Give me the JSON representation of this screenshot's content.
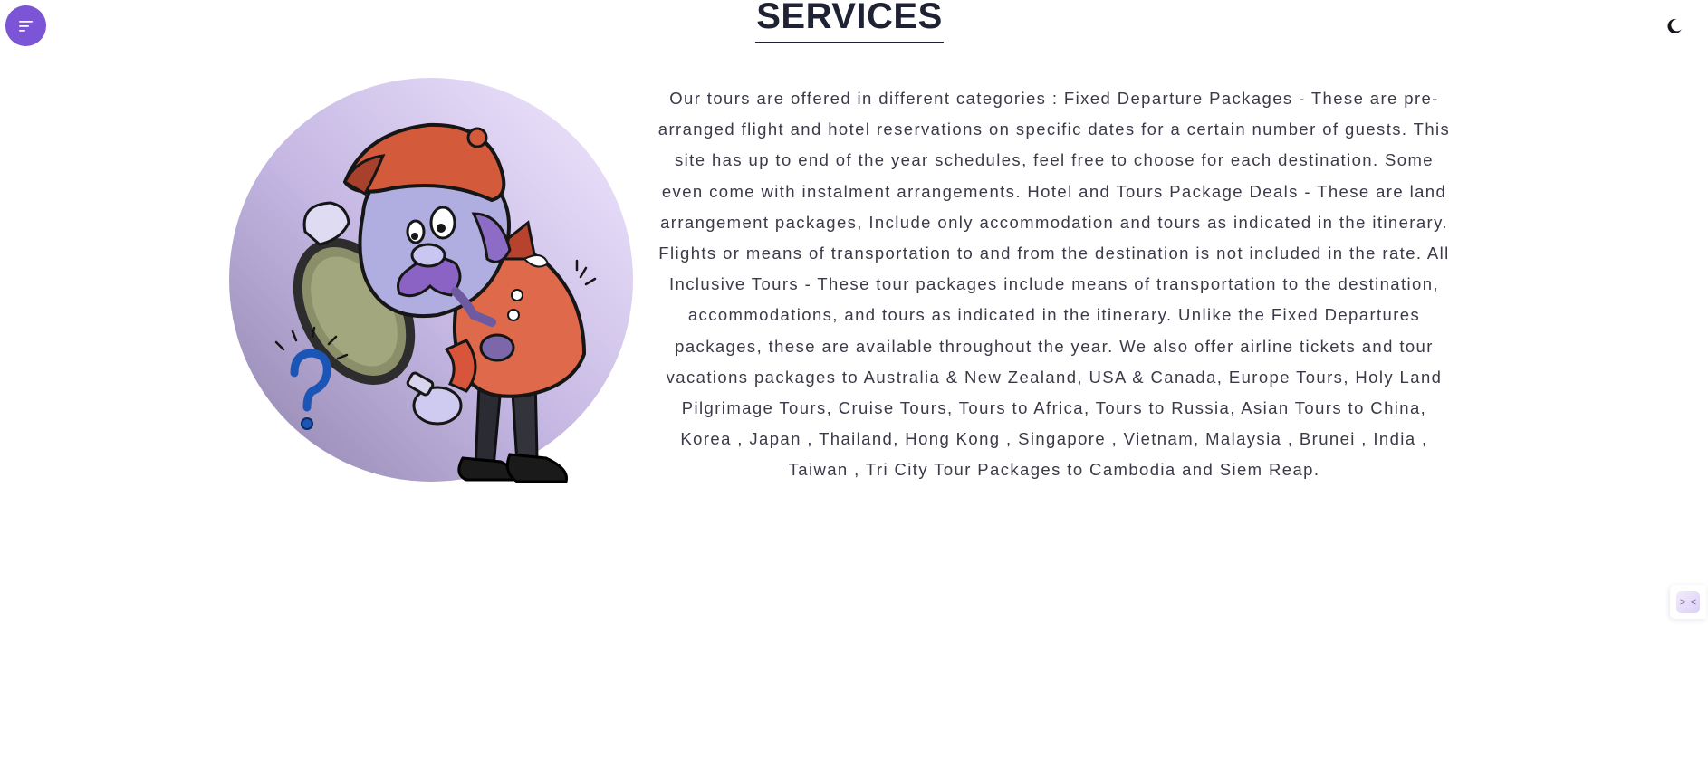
{
  "header": {
    "title": "SERVICES"
  },
  "icons": {
    "menu": "menu-lines-icon",
    "theme": "moon-icon",
    "widget": "code-chevrons-icon"
  },
  "colors": {
    "accent": "#7b55d6",
    "title": "#1e2233",
    "text": "#3a3a48"
  },
  "services": {
    "description": "Our tours are offered in different categories : Fixed Departure Packages - These are pre-arranged flight and hotel reservations on specific dates for a certain number of guests. This site has up to end of the year schedules, feel free to choose for each destination. Some even come with instalment arrangements. Hotel and Tours Package Deals - These are land arrangement packages, Include only accommodation and tours as indicated in the itinerary. Flights or means of transportation to and from the destination is not included in the rate. All Inclusive Tours - These tour packages include means of transportation to the destination, accommodations, and tours as indicated in the itinerary. Unlike the Fixed Departures packages, these are available throughout the year. We also offer airline tickets and tour vacations packages to Australia & New Zealand, USA & Canada, Europe Tours, Holy Land Pilgrimage Tours, Cruise Tours, Tours to Africa, Tours to Russia, Asian Tours to China, Korea , Japan , Thailand, Hong Kong , Singapore , Vietnam, Malaysia , Brunei , India , Taiwan , Tri City Tour Packages to Cambodia and Siem Reap."
  },
  "widget": {
    "glyph": ">_<"
  }
}
